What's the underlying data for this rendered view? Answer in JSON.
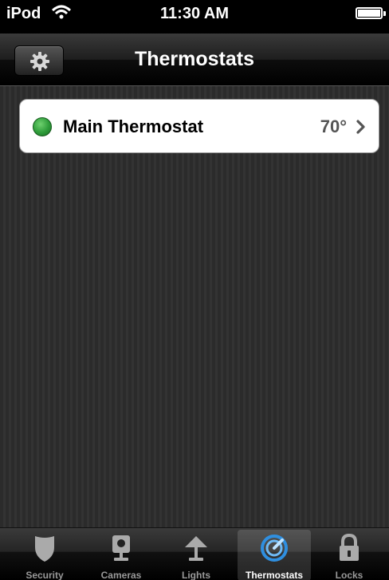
{
  "status_bar": {
    "carrier": "iPod",
    "time": "11:30 AM"
  },
  "nav": {
    "title": "Thermostats",
    "settings_icon": "gear-icon"
  },
  "thermostats": [
    {
      "name": "Main Thermostat",
      "temperature": "70°",
      "status_color": "#2e9c3a"
    }
  ],
  "tabs": [
    {
      "label": "Security",
      "icon": "shield-icon",
      "selected": false
    },
    {
      "label": "Cameras",
      "icon": "camera-icon",
      "selected": false
    },
    {
      "label": "Lights",
      "icon": "lamp-icon",
      "selected": false
    },
    {
      "label": "Thermostats",
      "icon": "thermostat-dial-icon",
      "selected": true
    },
    {
      "label": "Locks",
      "icon": "padlock-icon",
      "selected": false
    }
  ],
  "colors": {
    "selected_tab_icon": "#2f8fe0",
    "inactive_tab_icon": "#aaaaaa"
  }
}
